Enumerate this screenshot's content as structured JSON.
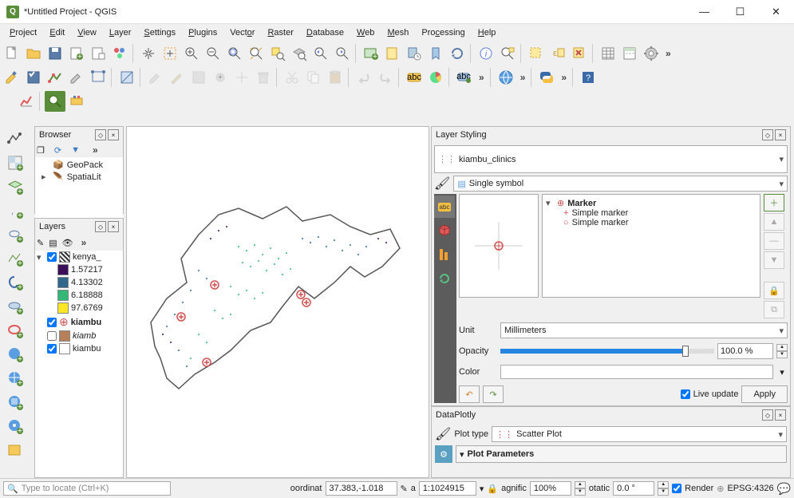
{
  "window": {
    "title": "*Untitled Project - QGIS"
  },
  "menu": [
    "Project",
    "Edit",
    "View",
    "Layer",
    "Settings",
    "Plugins",
    "Vector",
    "Raster",
    "Database",
    "Web",
    "Mesh",
    "Processing",
    "Help"
  ],
  "browser": {
    "title": "Browser",
    "items": [
      "GeoPack",
      "SpatiaLit"
    ]
  },
  "layers": {
    "title": "Layers",
    "rows": [
      {
        "checked": true,
        "type": "group",
        "label": "kenya_"
      },
      {
        "swatch": "#3b0f59",
        "label": "1.57217"
      },
      {
        "swatch": "#30678d",
        "label": "4.13302"
      },
      {
        "swatch": "#35b778",
        "label": "6.18888"
      },
      {
        "swatch": "#fde724",
        "label": "97.6769"
      },
      {
        "checked": true,
        "swatch": "#d66",
        "label": "kiambu",
        "bold": true,
        "marker": "plus"
      },
      {
        "checked": false,
        "swatch": "#b5805a",
        "label": "kiamb"
      },
      {
        "checked": true,
        "swatch": "#fff",
        "label": "kiambu"
      }
    ]
  },
  "styling": {
    "title": "Layer Styling",
    "layer": "kiambu_clinics",
    "renderer": "Single symbol",
    "tree": {
      "root": "Marker",
      "children": [
        "Simple marker",
        "Simple marker"
      ]
    },
    "unit_label": "Unit",
    "unit": "Millimeters",
    "opacity_label": "Opacity",
    "opacity": "100.0 %",
    "color_label": "Color",
    "live_update": "Live update",
    "apply": "Apply"
  },
  "plotly": {
    "title": "DataPlotly",
    "plot_type_label": "Plot type",
    "plot_type": "Scatter Plot",
    "params_header": "Plot Parameters"
  },
  "status": {
    "locate_placeholder": "Type to locate (Ctrl+K)",
    "coord_label": "oordinat",
    "coord": "37.383,-1.018",
    "scale_label": "a",
    "scale": "1:1024915",
    "mag_label": "agnific",
    "mag": "100%",
    "rot_label": "otatic",
    "rot": "0.0 °",
    "render": "Render",
    "crs": "EPSG:4326"
  }
}
